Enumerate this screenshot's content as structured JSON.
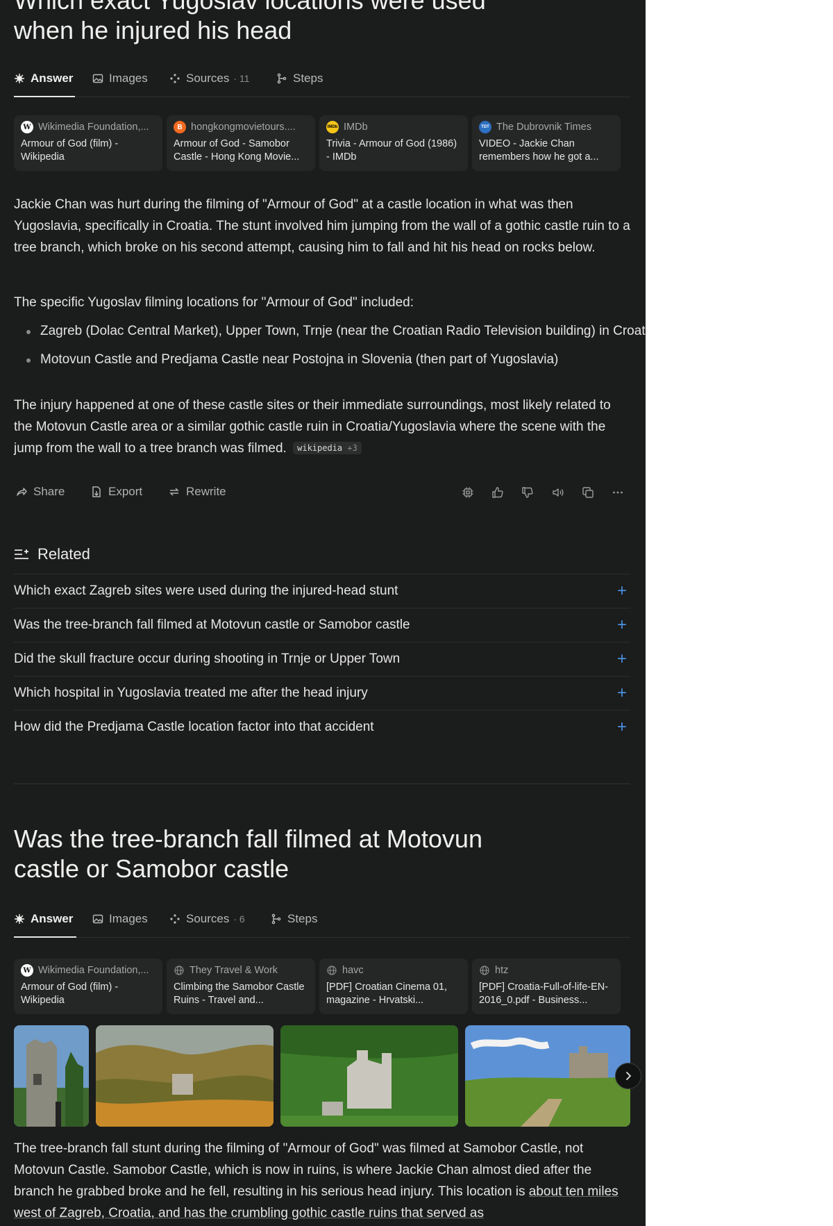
{
  "thread1": {
    "title_lines": [
      "Which exact Yugoslav locations were used",
      "when he injured his head"
    ],
    "tabs": {
      "answer": "Answer",
      "images": "Images",
      "sources": "Sources",
      "sources_count": "· 11",
      "steps": "Steps"
    },
    "sources": [
      {
        "site": "Wikimedia Foundation,...",
        "title": "Armour of God (film) - Wikipedia",
        "favicon": "W",
        "favicon_bg": "#ffffff",
        "favicon_fg": "#111111"
      },
      {
        "site": "hongkongmovietours....",
        "title": "Armour of God - Samobor Castle - Hong Kong Movie...",
        "favicon": "B",
        "favicon_bg": "#f26a21",
        "favicon_fg": "#ffffff"
      },
      {
        "site": "IMDb",
        "title": "Trivia - Armour of God (1986) - IMDb",
        "favicon": "IMDb",
        "favicon_bg": "#f5c518",
        "favicon_fg": "#000000"
      },
      {
        "site": "The Dubrovnik Times",
        "title": "VIDEO - Jackie Chan remembers how he got a...",
        "favicon": "TDT",
        "favicon_bg": "#2d6fc1",
        "favicon_fg": "#ffffff"
      }
    ],
    "para1": "Jackie Chan was hurt during the filming of \"Armour of God\" at a castle location in what was then Yugoslavia, specifically in Croatia. The stunt involved him jumping from the wall of a gothic castle ruin to a tree branch, which broke on his second attempt, causing him to fall and hit his head on rocks below.",
    "para2": "The specific Yugoslav filming locations for \"Armour of God\" included:",
    "bullets": [
      "Zagreb (Dolac Central Market), Upper Town, Trnje (near the Croatian Radio Television building) in Croatia",
      "Motovun Castle and Predjama Castle near Postojna in Slovenia (then part of Yugoslavia)"
    ],
    "para3": "The injury happened at one of these castle sites or their immediate surroundings, most likely related to the Motovun Castle area or a similar gothic castle ruin in Croatia/Yugoslavia where the scene with the jump from the wall to a tree branch was filmed.",
    "citation": {
      "label": "wikipedia",
      "more": "+3"
    },
    "actions": {
      "share": "Share",
      "export": "Export",
      "rewrite": "Rewrite"
    },
    "related_title": "Related",
    "related": [
      "Which exact Zagreb sites were used during the injured-head stunt",
      "Was the tree-branch fall filmed at Motovun castle or Samobor castle",
      "Did the skull fracture occur during shooting in Trnje or Upper Town",
      "Which hospital in Yugoslavia treated me after the head injury",
      "How did the Predjama Castle location factor into that accident"
    ]
  },
  "thread2": {
    "title_lines": [
      "Was the tree-branch fall filmed at Motovun",
      "castle or Samobor castle"
    ],
    "tabs": {
      "answer": "Answer",
      "images": "Images",
      "sources": "Sources",
      "sources_count": "· 6",
      "steps": "Steps"
    },
    "sources": [
      {
        "site": "Wikimedia Foundation,...",
        "title": "Armour of God (film) - Wikipedia",
        "favicon": "W",
        "favicon_bg": "#ffffff",
        "favicon_fg": "#111111"
      },
      {
        "site": "They Travel & Work",
        "title": "Climbing the Samobor Castle Ruins - Travel and...",
        "favicon": "globe",
        "favicon_bg": "transparent",
        "favicon_fg": "#8a8c8b"
      },
      {
        "site": "havc",
        "title": "[PDF] Croatian Cinema 01, magazine - Hrvatski...",
        "favicon": "globe",
        "favicon_bg": "transparent",
        "favicon_fg": "#8a8c8b"
      },
      {
        "site": "htz",
        "title": "[PDF] Croatia-Full-of-life-EN-2016_0.pdf - Business...",
        "favicon": "globe",
        "favicon_bg": "transparent",
        "favicon_fg": "#8a8c8b"
      }
    ],
    "para1_a": "The tree-branch fall stunt during the filming of \"Armour of God\" was filmed at Samobor Castle, not Motovun Castle. Samobor Castle, which is now in ruins, is where Jackie Chan almost died after the branch he grabbed broke and he fell, resulting in his serious head injury. This location is ",
    "para1_b": "about ten miles west of Zagreb, Croatia, and has the crumbling gothic castle ruins that served as"
  },
  "colors": {
    "panel_bg": "#1b1c1c",
    "card_bg": "#252727",
    "text": "#e4e4e2",
    "muted": "#b0b2b1",
    "accent_plus": "#4a8fe0"
  }
}
